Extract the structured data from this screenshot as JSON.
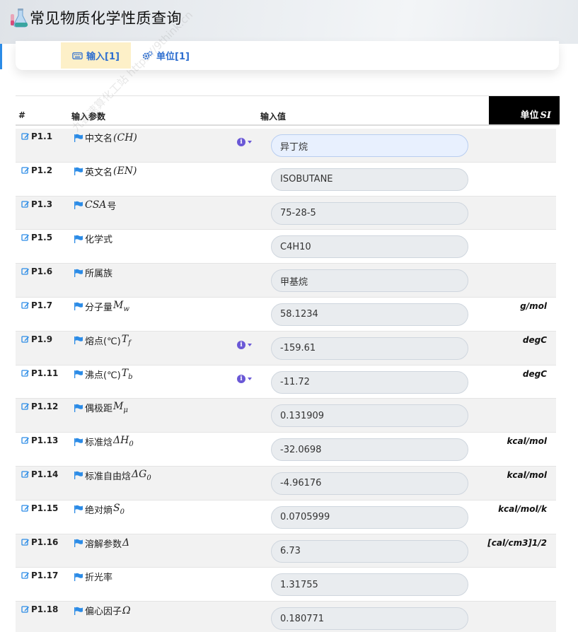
{
  "app": {
    "title": "常见物质化学性质查询"
  },
  "tabs": [
    {
      "label": "输入[1]",
      "active": true,
      "icon": "keyboard-icon"
    },
    {
      "label": "单位[1]",
      "active": false,
      "icon": "gears-icon"
    }
  ],
  "table": {
    "headers": {
      "num": "#",
      "param": "输入参数",
      "value": "输入值",
      "unit_prefix": "单位",
      "unit_symbol": "SI"
    },
    "rows": [
      {
        "id": "P1.1",
        "name": "中文名",
        "sym": "(CH)",
        "value": "异丁烷",
        "unit": "",
        "info": true,
        "focus": true
      },
      {
        "id": "P1.2",
        "name": "英文名",
        "sym": "(EN)",
        "value": "ISOBUTANE",
        "unit": "",
        "info": false
      },
      {
        "id": "P1.3",
        "name": "",
        "sym": "CSA",
        "suffix": "号",
        "value": "75-28-5",
        "unit": "",
        "info": false
      },
      {
        "id": "P1.5",
        "name": "化学式",
        "sym": "",
        "value": "C4H10",
        "unit": "",
        "info": false
      },
      {
        "id": "P1.6",
        "name": "所属族",
        "sym": "",
        "value": "甲基烷",
        "unit": "",
        "info": false
      },
      {
        "id": "P1.7",
        "name": "分子量",
        "sym": "M",
        "sub": "w",
        "value": "58.1234",
        "unit": "g/mol",
        "info": false
      },
      {
        "id": "P1.9",
        "name": "熔点(℃)",
        "sym": "T",
        "sub": "f",
        "value": "-159.61",
        "unit": "degC",
        "info": true
      },
      {
        "id": "P1.11",
        "name": "沸点(℃)",
        "sym": "T",
        "sub": "b",
        "value": "-11.72",
        "unit": "degC",
        "info": true
      },
      {
        "id": "P1.12",
        "name": "偶极距",
        "sym": "M",
        "sub": "μ",
        "value": "0.131909",
        "unit": "",
        "info": false
      },
      {
        "id": "P1.13",
        "name": "标准焓",
        "sym": "ΔH",
        "sub": "0",
        "value": "-32.0698",
        "unit": "kcal/mol",
        "info": false
      },
      {
        "id": "P1.14",
        "name": "标准自由焓",
        "sym": "ΔG",
        "sub": "0",
        "value": "-4.96176",
        "unit": "kcal/mol",
        "info": false
      },
      {
        "id": "P1.15",
        "name": "绝对熵",
        "sym": "S",
        "sub": "0",
        "value": "0.0705999",
        "unit": "kcal/mol/k",
        "info": false
      },
      {
        "id": "P1.16",
        "name": "溶解参数",
        "sym": "Δ",
        "value": "6.73",
        "unit": "[cal/cm3]1/2",
        "info": false
      },
      {
        "id": "P1.17",
        "name": "折光率",
        "sym": "",
        "value": "1.31755",
        "unit": "",
        "info": false
      },
      {
        "id": "P1.18",
        "name": "偏心因子",
        "sym": "Ω",
        "value": "0.180771",
        "unit": "",
        "info": false
      }
    ]
  },
  "info_glyph": "i",
  "colors": {
    "accent": "#2f6fd0",
    "tab_active_bg": "#fdf0c8",
    "info": "#6a58d6",
    "flag": "#2b8be6"
  }
}
